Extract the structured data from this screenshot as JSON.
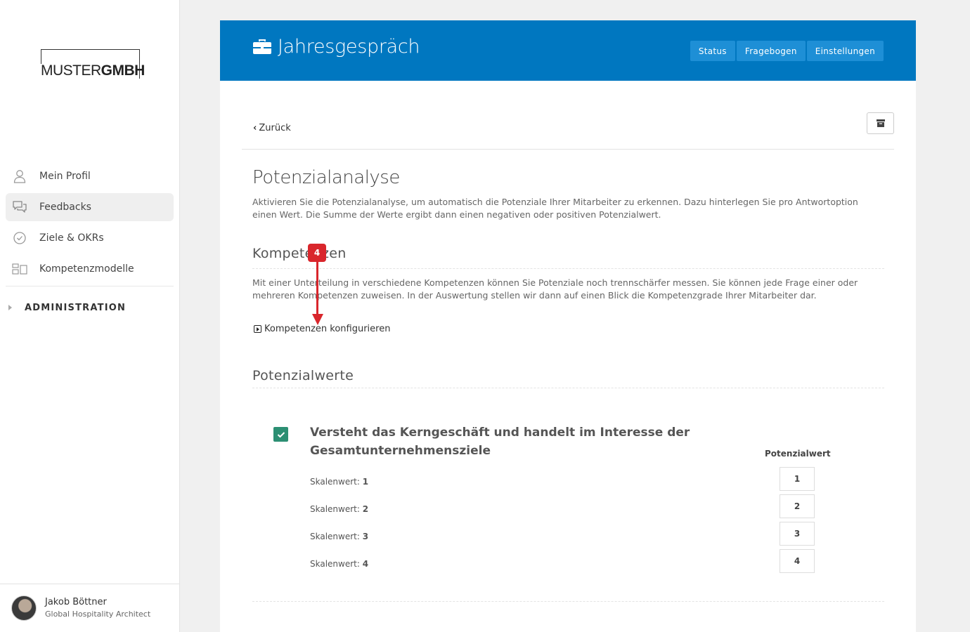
{
  "logo": {
    "text_light": "MUSTER",
    "text_bold": "GMBH"
  },
  "sidebar": {
    "items": [
      {
        "label": "Mein Profil",
        "icon": "user-icon"
      },
      {
        "label": "Feedbacks",
        "icon": "chat-icon"
      },
      {
        "label": "Ziele & OKRs",
        "icon": "check-circle-icon"
      },
      {
        "label": "Kompetenzmodelle",
        "icon": "grid-icon"
      }
    ],
    "admin_label": "ADMINISTRATION",
    "user": {
      "name": "Jakob Böttner",
      "role": "Global Hospitality Architect"
    }
  },
  "header": {
    "title": "Jahresgespräch",
    "buttons": [
      "Status",
      "Fragebogen",
      "Einstellungen"
    ],
    "color": "#0077c0"
  },
  "back_label": "Zurück",
  "potenzial": {
    "title": "Potenzialanalyse",
    "description": "Aktivieren Sie die Potenzialanalyse, um automatisch die Potenziale Ihrer Mitarbeiter zu erkennen. Dazu hinterlegen Sie pro Antwortoption einen Wert. Die Summe der Werte ergibt dann einen negativen oder positiven Potenzialwert."
  },
  "kompetenzen": {
    "title": "Kompetenzen",
    "description": "Mit einer Unterteilung in verschiedene Kompetenzen können Sie Potenziale noch trennschärfer messen. Sie können jede Frage einer oder mehreren Kompetenzen zuweisen. In der Auswertung stellen wir dann auf einen Blick die Kompetenzgrade Ihrer Mitarbeiter dar.",
    "configure_label": "Kompetenzen konfigurieren"
  },
  "annotation": {
    "number": "4"
  },
  "potenzialwerte": {
    "title": "Potenzialwerte",
    "question": "Versteht das Kerngeschäft und handelt im Interesse der Gesamtunternehmensziele",
    "column_label": "Potenzialwert",
    "scale_label": "Skalenwert:",
    "rows": [
      {
        "scale": "1",
        "value": "1"
      },
      {
        "scale": "2",
        "value": "2"
      },
      {
        "scale": "3",
        "value": "3"
      },
      {
        "scale": "4",
        "value": "4"
      }
    ],
    "check_color": "#2c8f73"
  }
}
